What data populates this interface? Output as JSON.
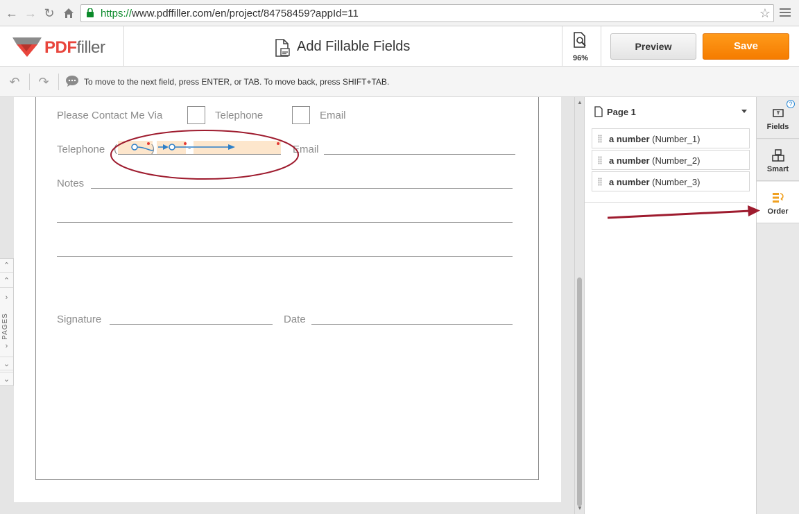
{
  "browser": {
    "url_scheme": "https://",
    "url_rest": "www.pdffiller.com/en/project/84758459?appId=11",
    "icons": [
      "back-icon",
      "forward-icon",
      "reload-icon",
      "home-icon",
      "lock-icon",
      "star-icon",
      "menu-icon"
    ]
  },
  "header": {
    "logo_pdf": "PDF",
    "logo_filler": "filler",
    "title": "Add Fillable Fields",
    "zoom": "96%",
    "preview_label": "Preview",
    "save_label": "Save",
    "accent_color": "#f57c00",
    "brand_color": "#e8453c"
  },
  "hint_bar": {
    "text": "To move to the next field, press ENTER, or TAB. To move back, press SHIFT+TAB."
  },
  "document": {
    "contact_label": "Please Contact Me Via",
    "telephone_option": "Telephone",
    "email_option": "Email",
    "telephone_label": "Telephone",
    "paren_open": "(",
    "paren_close": ")",
    "dash": "-",
    "email_label": "Email",
    "notes_label": "Notes",
    "signature_label": "Signature",
    "date_label": "Date",
    "annotation_color": "#9e1b2e",
    "flow_color": "#2d7fc8"
  },
  "pages_tab": {
    "label": "PAGES"
  },
  "right_panel": {
    "page_selector": "Page 1",
    "order_items": [
      {
        "type": "a number",
        "name": "(Number_1)"
      },
      {
        "type": "a number",
        "name": "(Number_2)"
      },
      {
        "type": "a number",
        "name": "(Number_3)"
      }
    ]
  },
  "side_tabs": [
    {
      "label": "Fields",
      "icon": "fields-icon"
    },
    {
      "label": "Smart",
      "icon": "smart-icon"
    },
    {
      "label": "Order",
      "icon": "order-icon"
    }
  ],
  "help": "?"
}
